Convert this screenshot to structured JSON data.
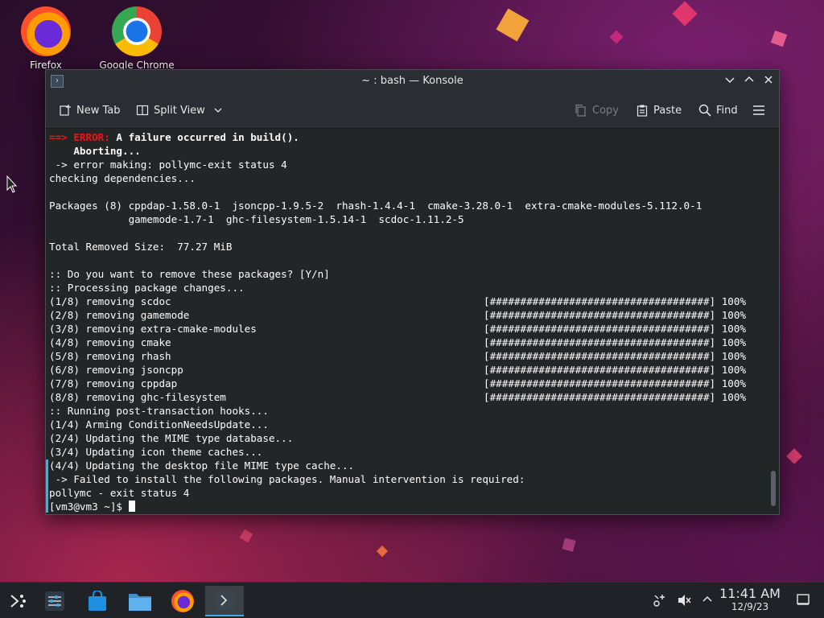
{
  "desktop": {
    "icons": [
      {
        "label": "Firefox"
      },
      {
        "label": "Google Chrome"
      }
    ]
  },
  "window": {
    "title": "~ : bash — Konsole",
    "toolbar": {
      "new_tab": "New Tab",
      "split_view": "Split View",
      "copy": "Copy",
      "paste": "Paste",
      "find": "Find"
    }
  },
  "terminal": {
    "lines": [
      {
        "parts": [
          {
            "t": "==> ",
            "c": "red"
          },
          {
            "t": "ERROR: ",
            "c": "red"
          },
          {
            "t": "A failure occurred in build().",
            "c": "bold"
          }
        ]
      },
      {
        "parts": [
          {
            "t": "    Aborting...",
            "c": "bold"
          }
        ]
      },
      {
        "parts": [
          {
            "t": " -> error making: pollymc-exit status 4"
          }
        ]
      },
      {
        "parts": [
          {
            "t": "checking dependencies..."
          }
        ]
      },
      {
        "parts": [
          {
            "t": ""
          }
        ]
      },
      {
        "parts": [
          {
            "t": "Packages (8) cppdap-1.58.0-1  jsoncpp-1.9.5-2  rhash-1.4.4-1  cmake-3.28.0-1  extra-cmake-modules-5.112.0-1"
          }
        ]
      },
      {
        "parts": [
          {
            "t": "             gamemode-1.7-1  ghc-filesystem-1.5.14-1  scdoc-1.11.2-5"
          }
        ]
      },
      {
        "parts": [
          {
            "t": ""
          }
        ]
      },
      {
        "parts": [
          {
            "t": "Total Removed Size:  77.27 MiB"
          }
        ]
      },
      {
        "parts": [
          {
            "t": ""
          }
        ]
      },
      {
        "parts": [
          {
            "t": ":: Do you want to remove these packages? [Y/n]"
          }
        ]
      },
      {
        "parts": [
          {
            "t": ":: Processing package changes..."
          }
        ]
      },
      {
        "parts": [
          {
            "t": "(1/8) removing scdoc"
          }
        ],
        "progress": "[####################################] 100%"
      },
      {
        "parts": [
          {
            "t": "(2/8) removing gamemode"
          }
        ],
        "progress": "[####################################] 100%"
      },
      {
        "parts": [
          {
            "t": "(3/8) removing extra-cmake-modules"
          }
        ],
        "progress": "[####################################] 100%"
      },
      {
        "parts": [
          {
            "t": "(4/8) removing cmake"
          }
        ],
        "progress": "[####################################] 100%"
      },
      {
        "parts": [
          {
            "t": "(5/8) removing rhash"
          }
        ],
        "progress": "[####################################] 100%"
      },
      {
        "parts": [
          {
            "t": "(6/8) removing jsoncpp"
          }
        ],
        "progress": "[####################################] 100%"
      },
      {
        "parts": [
          {
            "t": "(7/8) removing cppdap"
          }
        ],
        "progress": "[####################################] 100%"
      },
      {
        "parts": [
          {
            "t": "(8/8) removing ghc-filesystem"
          }
        ],
        "progress": "[####################################] 100%"
      },
      {
        "parts": [
          {
            "t": ":: Running post-transaction hooks..."
          }
        ]
      },
      {
        "parts": [
          {
            "t": "(1/4) Arming ConditionNeedsUpdate..."
          }
        ]
      },
      {
        "parts": [
          {
            "t": "(2/4) Updating the MIME type database..."
          }
        ]
      },
      {
        "parts": [
          {
            "t": "(3/4) Updating icon theme caches..."
          }
        ]
      },
      {
        "parts": [
          {
            "t": "(4/4) Updating the desktop file MIME type cache..."
          }
        ]
      },
      {
        "parts": [
          {
            "t": " -> Failed to install the following packages. Manual intervention is required:"
          }
        ]
      },
      {
        "parts": [
          {
            "t": "pollymc - exit status 4"
          }
        ]
      }
    ],
    "prompt": "[vm3@vm3 ~]$ "
  },
  "taskbar": {
    "time": "11:41 AM",
    "date": "12/9/23"
  }
}
